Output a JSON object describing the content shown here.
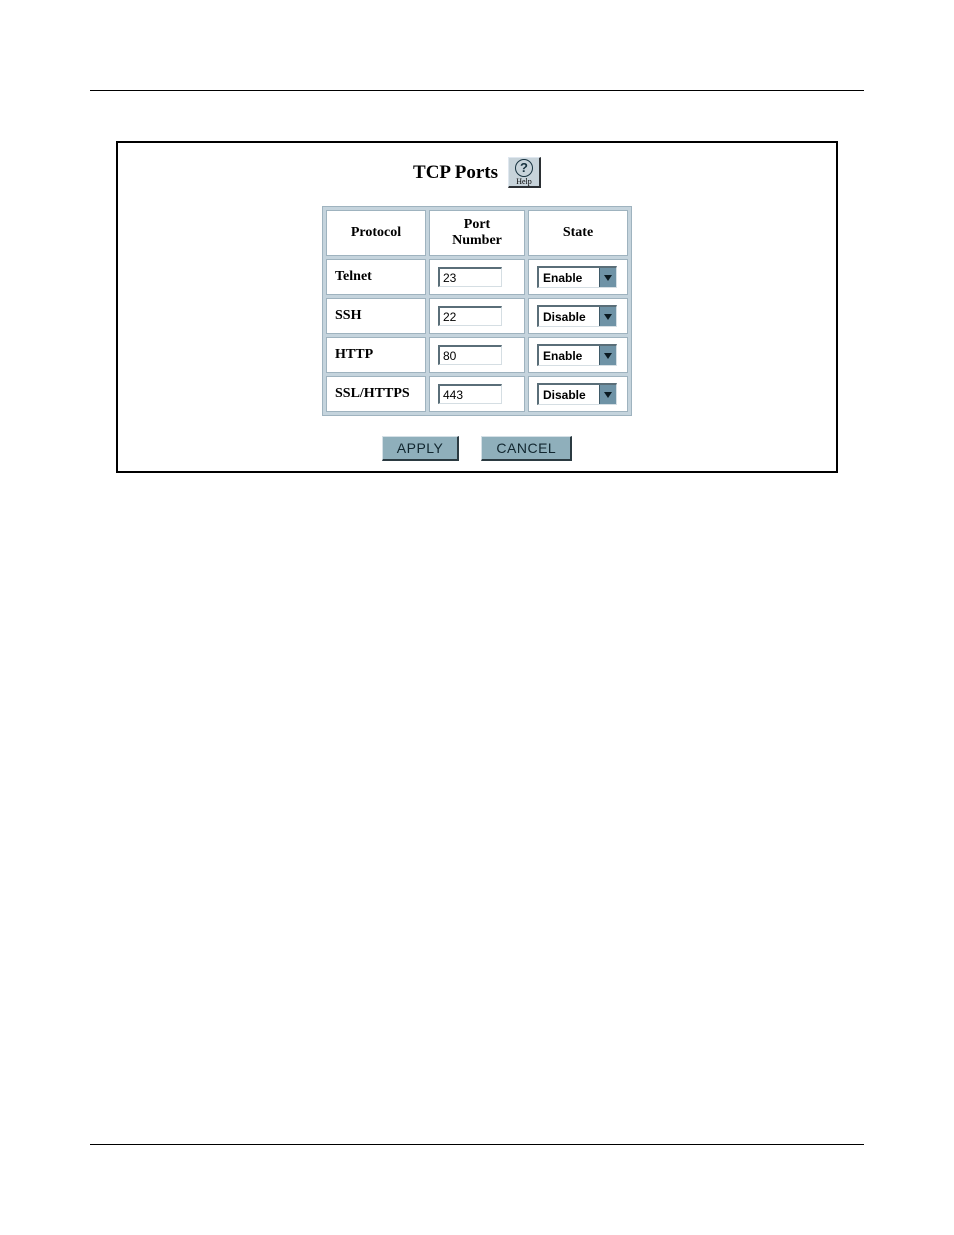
{
  "panel": {
    "title": "TCP Ports",
    "help_q": "?",
    "help_label": "Help"
  },
  "table": {
    "headers": {
      "protocol": "Protocol",
      "port": "Port Number",
      "state": "State"
    },
    "rows": [
      {
        "protocol": "Telnet",
        "port": "23",
        "state": "Enable"
      },
      {
        "protocol": "SSH",
        "port": "22",
        "state": "Disable"
      },
      {
        "protocol": "HTTP",
        "port": "80",
        "state": "Enable"
      },
      {
        "protocol": "SSL/HTTPS",
        "port": "443",
        "state": "Disable"
      }
    ]
  },
  "buttons": {
    "apply": "APPLY",
    "cancel": "CANCEL"
  }
}
